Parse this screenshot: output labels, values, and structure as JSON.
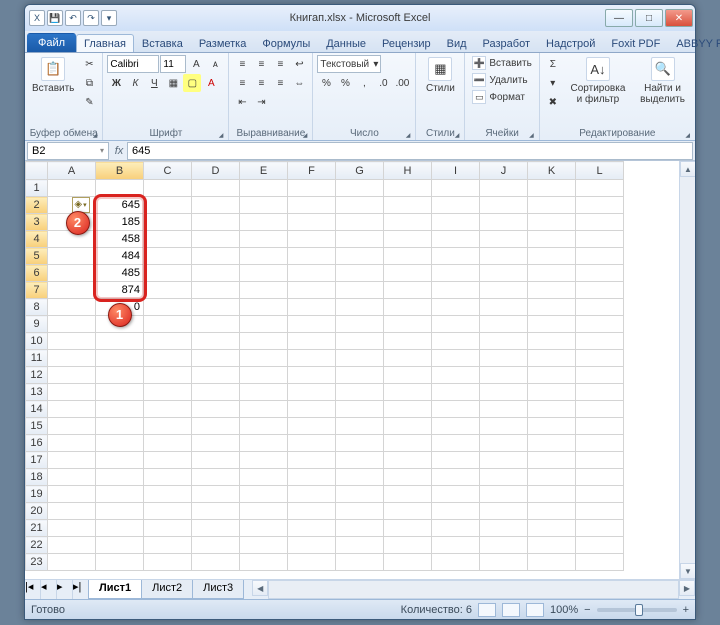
{
  "title": {
    "doc": "Книгап.xlsx",
    "app": "Microsoft Excel",
    "sep": " - "
  },
  "qat": {
    "excel": "X",
    "save": "💾",
    "undo": "↶",
    "redo": "↷",
    "more": "▾"
  },
  "winbtns": {
    "min": "—",
    "max": "□",
    "close": "✕"
  },
  "tabs": {
    "file": "Файл",
    "items": [
      "Главная",
      "Вставка",
      "Разметка",
      "Формулы",
      "Данные",
      "Рецензир",
      "Вид",
      "Разработ",
      "Надстрой",
      "Foxit PDF",
      "ABBYY PD"
    ],
    "active": 0,
    "help": "?",
    "mdi_min": "–",
    "mdi_close": "✕"
  },
  "ribbon": {
    "clipboard": {
      "paste": "Вставить",
      "label": "Буфер обмена",
      "icon": "📋"
    },
    "font": {
      "name": "Calibri",
      "size": "11",
      "label": "Шрифт",
      "bold": "Ж",
      "italic": "К",
      "underline": "Ч",
      "border": "▦",
      "fill": "▢",
      "color": "A",
      "grow": "A",
      "shrink": "ᴀ"
    },
    "align": {
      "label": "Выравнивание",
      "tl": "≡",
      "tc": "≡",
      "tr": "≡",
      "ml": "≡",
      "mc": "≡",
      "mr": "≡",
      "wrap": "↩",
      "merge": "⇔",
      "il": "⇤",
      "ir": "⇥"
    },
    "number": {
      "label": "Число",
      "format": "Текстовый",
      "cur": "%",
      "pct": "%",
      "comma": ",",
      "inc": ".0",
      "dec": ".00",
      "dd": "▾"
    },
    "styles": {
      "label": "Стили",
      "btn": "Стили",
      "icon": "▦"
    },
    "cells": {
      "label": "Ячейки",
      "insert": "Вставить",
      "delete": "Удалить",
      "format": "Формат",
      "ii": "➕",
      "di": "➖",
      "fi": "▭"
    },
    "editing": {
      "label": "Редактирование",
      "sum": "Σ",
      "fill": "▾",
      "clear": "✖",
      "sort": "Сортировка и фильтр",
      "find": "Найти и выделить",
      "si": "A↓",
      "fi2": "🔍"
    }
  },
  "formula_bar": {
    "name": "B2",
    "fx": "fx",
    "value": "645",
    "dd": "▾"
  },
  "columns": [
    "A",
    "B",
    "C",
    "D",
    "E",
    "F",
    "G",
    "H",
    "I",
    "J",
    "K",
    "L"
  ],
  "rows": 23,
  "data": {
    "B2": "645",
    "B3": "185",
    "B4": "458",
    "B5": "484",
    "B6": "485",
    "B7": "874",
    "B8": "0"
  },
  "selection": {
    "col": "B",
    "rows_from": 2,
    "rows_to": 7,
    "active": "B2"
  },
  "smart_tag": {
    "glyph": "◈",
    "dd": "▾"
  },
  "callouts": {
    "c1": "1",
    "c2": "2"
  },
  "sheet_tabs": {
    "items": [
      "Лист1",
      "Лист2",
      "Лист3"
    ],
    "active": 0,
    "nav": [
      "|◂",
      "◂",
      "▸",
      "▸|"
    ]
  },
  "status": {
    "ready": "Готово",
    "count_label": "Количество: ",
    "count": "6",
    "zoom": "100%",
    "minus": "−",
    "plus": "+"
  }
}
